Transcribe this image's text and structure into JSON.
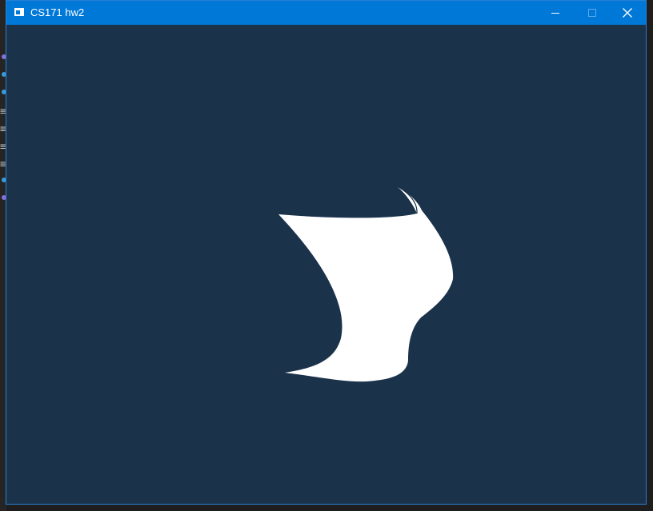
{
  "window": {
    "title": "CS171 hw2"
  },
  "colors": {
    "titlebar": "#0078d7",
    "viewport_background": "#1b324b",
    "shape_fill": "#ffffff"
  },
  "icons": {
    "app": "app-window-icon",
    "minimize": "minimize-icon",
    "maximize": "maximize-icon",
    "close": "close-icon"
  }
}
